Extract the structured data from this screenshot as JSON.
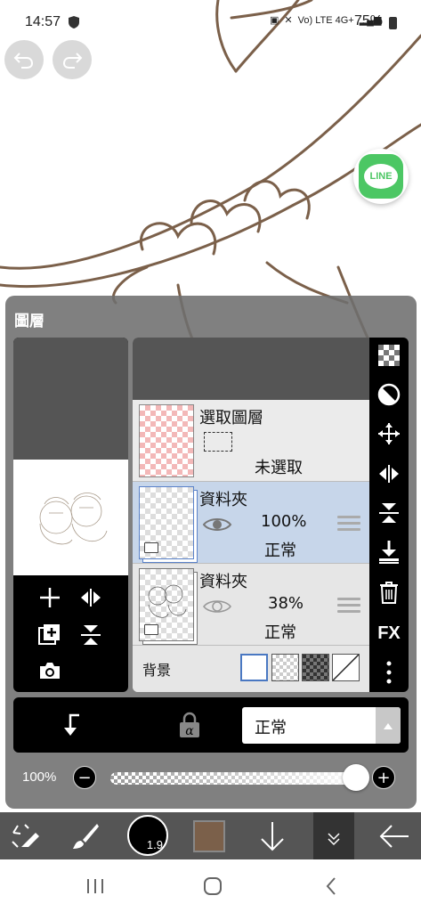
{
  "status_bar": {
    "time": "14:57",
    "network": "Vo) LTE 4G+",
    "battery": "75%"
  },
  "layer_panel": {
    "title": "圖層",
    "layers": [
      {
        "name": "選取圖層",
        "status": "未選取",
        "type": "selection"
      },
      {
        "name": "資料夾",
        "opacity": "100%",
        "blend_mode": "正常",
        "visible": true,
        "selected": true,
        "type": "folder"
      },
      {
        "name": "資料夾",
        "opacity": "38%",
        "blend_mode": "正常",
        "visible": true,
        "selected": false,
        "type": "folder"
      }
    ],
    "background": {
      "label": "背景",
      "options": [
        "white",
        "transparent-light",
        "transparent-dark",
        "none"
      ],
      "selected": "white"
    },
    "side_tools": [
      "transparency-icon",
      "halftone-icon",
      "move-icon",
      "flip-horizontal-icon",
      "flip-vertical-icon",
      "merge-down-icon",
      "trash-icon",
      "fx-button",
      "more-icon"
    ],
    "fx_label": "FX",
    "blend_select": {
      "value": "正常"
    },
    "opacity": {
      "label": "100%",
      "value": 1.0
    }
  },
  "toolbar": {
    "brush_size": "1.9",
    "brush_color": "#7b604a"
  },
  "colors": {
    "line_art": "#7b604a",
    "selected_layer": "#c7d6ea",
    "line_green": "#4cc764"
  },
  "line_badge": "LINE"
}
